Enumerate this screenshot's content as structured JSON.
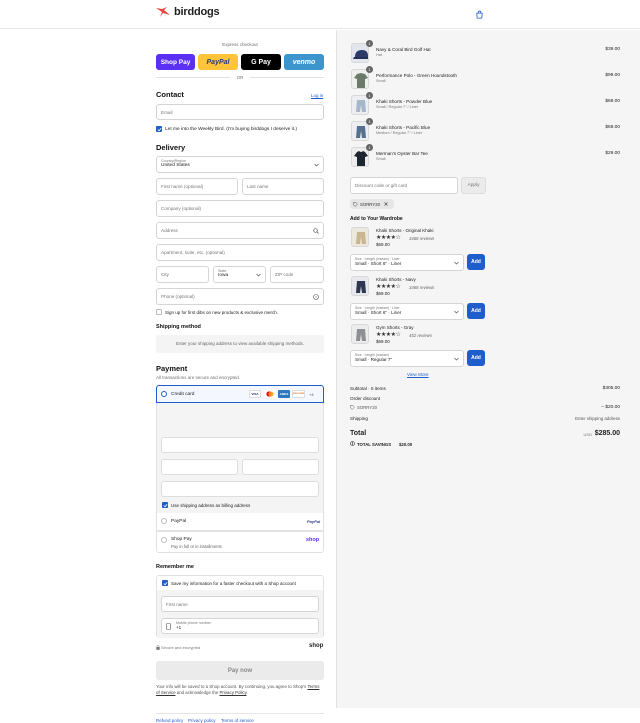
{
  "brand": {
    "name": "birddogs",
    "accent": "#1f5ccc",
    "logo_color": "#e8463b"
  },
  "express": {
    "label": "Express checkout",
    "or": "OR",
    "buttons": [
      {
        "label": "Shop Pay",
        "bg": "#5a31f4"
      },
      {
        "label": "PayPal",
        "bg": "#ffc439"
      },
      {
        "label": "G Pay",
        "bg": "#000000"
      },
      {
        "label": "venmo",
        "bg": "#3d95ce"
      }
    ]
  },
  "contact": {
    "title": "Contact",
    "login": "Log in",
    "email_placeholder": "Email",
    "newsletter": "Let me into the Weekly Bird. (I'm buying birddogs I deserve it.)"
  },
  "delivery": {
    "title": "Delivery",
    "country_label": "Country/Region",
    "country_value": "United States",
    "first_name": "First name (optional)",
    "last_name": "Last name",
    "company": "Company (optional)",
    "address": "Address",
    "apartment": "Apartment, suite, etc. (optional)",
    "city": "City",
    "state_label": "State",
    "state_value": "Iowa",
    "zip": "ZIP code",
    "phone": "Phone (optional)",
    "sms": "Sign up for first dibs on new products & exclusive merch."
  },
  "shipping": {
    "title": "Shipping method",
    "notice": "Enter your shipping address to view available shipping methods."
  },
  "payment": {
    "title": "Payment",
    "subtitle": "All transactions are secure and encrypted.",
    "credit_card": "Credit card",
    "card_brands": [
      "VISA",
      "MC",
      "AMEX",
      "DISCOVER",
      "+4"
    ],
    "billing_same": "Use shipping address as billing address",
    "paypal": "PayPal",
    "paypal_logo": "PayPal",
    "shop_pay": "Shop Pay",
    "shop_pay_sub": "Pay in full or in installments",
    "shop_logo": "shop"
  },
  "remember": {
    "title": "Remember me",
    "save": "Save my information for a faster checkout with a Shop account",
    "first_name": "First name",
    "mobile_label": "Mobile phone number",
    "mobile_value": "+1",
    "secure": "Secure and encrypted",
    "shop": "shop"
  },
  "pay_now": "Pay now",
  "legal": {
    "line1": "Your info will be saved to a Shop account. By continuing, you agree to Shop's",
    "tos": "Terms of Service",
    "and": "and acknowledge the",
    "privacy": "Privacy Policy",
    "end": "."
  },
  "footer_links": [
    "Refund policy",
    "Privacy policy",
    "Terms of service"
  ],
  "cart": {
    "items": [
      {
        "qty": "1",
        "name": "Navy & Coral Bird Golf Hat",
        "variant": "Hat",
        "price": "$39.00"
      },
      {
        "qty": "1",
        "name": "Performance Polo - Green Houndstooth",
        "variant": "Small",
        "price": "$99.00"
      },
      {
        "qty": "1",
        "name": "Khaki Shorts - Powder Blue",
        "variant": "Small / Regular 7\" / Liner",
        "price": "$69.00"
      },
      {
        "qty": "1",
        "name": "Khaki Shorts - Pacific Blue",
        "variant": "Medium / Regular 7\" / Liner",
        "price": "$69.00"
      },
      {
        "qty": "1",
        "name": "Merman's Oyster Bar Tee",
        "variant": "Small",
        "price": "$29.00"
      }
    ],
    "discount_placeholder": "Discount code or gift card",
    "apply": "Apply",
    "code": "SORRY20"
  },
  "upsell": {
    "title": "Add to Your Wardrobe",
    "items": [
      {
        "name": "Khaki Shorts - Original Khaki",
        "reviews": "3468 reviews",
        "price": "$69.00",
        "select_label": "Size · Length (inseam) · Liner",
        "select_value": "Small · Short 6\" · Liner",
        "add": "Add"
      },
      {
        "name": "Khaki Shorts - Navy",
        "reviews": "3468 reviews",
        "price": "$69.00",
        "select_label": "Size · Length (inseam) · Liner",
        "select_value": "Small · Short 6\" · Liner",
        "add": "Add"
      },
      {
        "name": "Gym Shorts - Gray",
        "reviews": "452 reviews",
        "price": "$69.00",
        "select_label": "Size · Length (inseam)",
        "select_value": "Small · Regular 7\"",
        "add": "Add"
      }
    ],
    "stars": "★★★★☆",
    "view_more": "View More"
  },
  "summary": {
    "subtotal_label": "Subtotal · 5 items",
    "subtotal_value": "$305.00",
    "order_discount": "Order discount",
    "discount_code": "SORRY20",
    "discount_value": "− $20.00",
    "shipping_label": "Shipping",
    "shipping_value": "Enter shipping address",
    "total_label": "Total",
    "currency": "USD",
    "total_value": "$285.00",
    "savings_label": "TOTAL SAVINGS",
    "savings_value": "$20.00"
  }
}
